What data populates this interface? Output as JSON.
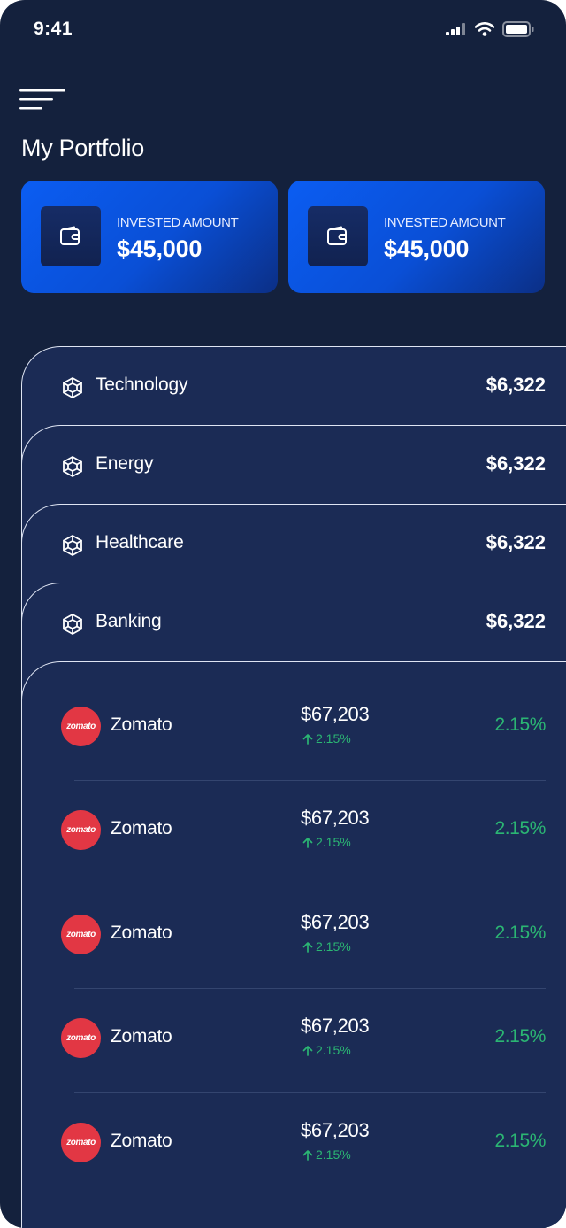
{
  "status_bar": {
    "time": "9:41"
  },
  "page": {
    "title": "My Portfolio"
  },
  "summary_cards": [
    {
      "label": "INVESTED AMOUNT",
      "value": "$45,000"
    },
    {
      "label": "INVESTED AMOUNT",
      "value": "$45,000"
    }
  ],
  "sectors": [
    {
      "name": "Technology",
      "value": "$6,322"
    },
    {
      "name": "Energy",
      "value": "$6,322"
    },
    {
      "name": "Healthcare",
      "value": "$6,322"
    },
    {
      "name": "Banking",
      "value": "$6,322"
    }
  ],
  "stocks": [
    {
      "logo_text": "zomato",
      "name": "Zomato",
      "price": "$67,203",
      "delta": "2.15%",
      "change": "2.15%"
    },
    {
      "logo_text": "zomato",
      "name": "Zomato",
      "price": "$67,203",
      "delta": "2.15%",
      "change": "2.15%"
    },
    {
      "logo_text": "zomato",
      "name": "Zomato",
      "price": "$67,203",
      "delta": "2.15%",
      "change": "2.15%"
    },
    {
      "logo_text": "zomato",
      "name": "Zomato",
      "price": "$67,203",
      "delta": "2.15%",
      "change": "2.15%"
    },
    {
      "logo_text": "zomato",
      "name": "Zomato",
      "price": "$67,203",
      "delta": "2.15%",
      "change": "2.15%"
    }
  ],
  "colors": {
    "background": "#14213d",
    "panel": "#1b2b55",
    "card_accent": "#0b5df2",
    "positive": "#2bb673",
    "zomato_brand": "#e23744"
  },
  "icons": {
    "menu": "hamburger-menu-icon",
    "wallet": "wallet-icon",
    "sector": "network-hub-icon",
    "delta": "arrow-up-icon"
  }
}
